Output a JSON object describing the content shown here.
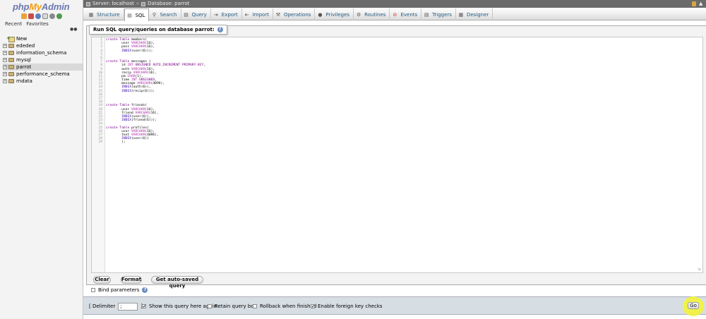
{
  "nav": {
    "logo_php": "php",
    "logo_my": "My",
    "logo_admin": "Admin",
    "tabs": [
      "Recent",
      "Favorites"
    ],
    "icons": [
      "home-icon",
      "logout-icon",
      "help-icon",
      "docs-icon",
      "settings-icon",
      "reload-icon"
    ],
    "tree": [
      {
        "label": "New",
        "type": "new"
      },
      {
        "label": "ededed",
        "type": "db"
      },
      {
        "label": "information_schema",
        "type": "db"
      },
      {
        "label": "mysql",
        "type": "db"
      },
      {
        "label": "parrot",
        "type": "db",
        "selected": true
      },
      {
        "label": "performance_schema",
        "type": "db"
      },
      {
        "label": "rndata",
        "type": "db"
      }
    ]
  },
  "breadcrumb": {
    "server": "Server: localhost",
    "database": "Database: parrot"
  },
  "tabs": [
    {
      "label": "Structure",
      "icon": "structure-icon"
    },
    {
      "label": "SQL",
      "icon": "sql-icon",
      "active": true
    },
    {
      "label": "Search",
      "icon": "search-icon"
    },
    {
      "label": "Query",
      "icon": "query-icon"
    },
    {
      "label": "Export",
      "icon": "export-icon"
    },
    {
      "label": "Import",
      "icon": "import-icon"
    },
    {
      "label": "Operations",
      "icon": "operations-icon"
    },
    {
      "label": "Privileges",
      "icon": "privileges-icon"
    },
    {
      "label": "Routines",
      "icon": "routines-icon"
    },
    {
      "label": "Events",
      "icon": "events-icon"
    },
    {
      "label": "Triggers",
      "icon": "triggers-icon"
    },
    {
      "label": "Designer",
      "icon": "designer-icon"
    }
  ],
  "legend": "Run SQL query/queries on database parrot:",
  "editor": {
    "lines": [
      "create Table members(",
      "        user VARCHAR(16),",
      "        pass VARCHAR(16),",
      "        INDEX(user(6)));",
      "",
      "",
      "create Table messages (",
      "        id INT UNSIGNED AUTO_INCREMENT PRIMARY KEY,",
      "        auth VARCHAR(16),",
      "        recip VARCHAR(16),",
      "        pm CHAR(1),",
      "        time INT UNSIGNED,",
      "        message VARCHAR(4096),",
      "        INDEX(auth(6)),",
      "        INDEX(recip(6)));",
      "",
      "",
      "",
      "create Table friends(",
      "        user VARCHAR(16),",
      "        friend VARCHAR(16),",
      "        INDEX(user(6)),",
      "        INDEX(friend(6)));",
      "",
      "create Table profiles(",
      "        user VARCHAR(16),",
      "        text VARCHAR(4096),",
      "        INDEX(user(6))",
      "        );"
    ]
  },
  "buttons": {
    "clear": "Clear",
    "format": "Format",
    "autosaved": "Get auto-saved query"
  },
  "bind_params": "Bind parameters",
  "bottom": {
    "delimiter_label": "[ Delimiter",
    "delimiter_value": ";",
    "delimiter_close": "]",
    "show_query": {
      "label": "Show this query here again",
      "checked": true
    },
    "retain": {
      "label": "Retain query box",
      "checked": false
    },
    "rollback": {
      "label": "Rollback when finished",
      "checked": false
    },
    "foreign": {
      "label": "Enable foreign key checks",
      "checked": true
    },
    "go": "Go"
  },
  "colors": {
    "topbar": "#6b6b6b",
    "tab_text": "#235a81",
    "highlight": "#f3f33a",
    "keyword": "#770088"
  }
}
